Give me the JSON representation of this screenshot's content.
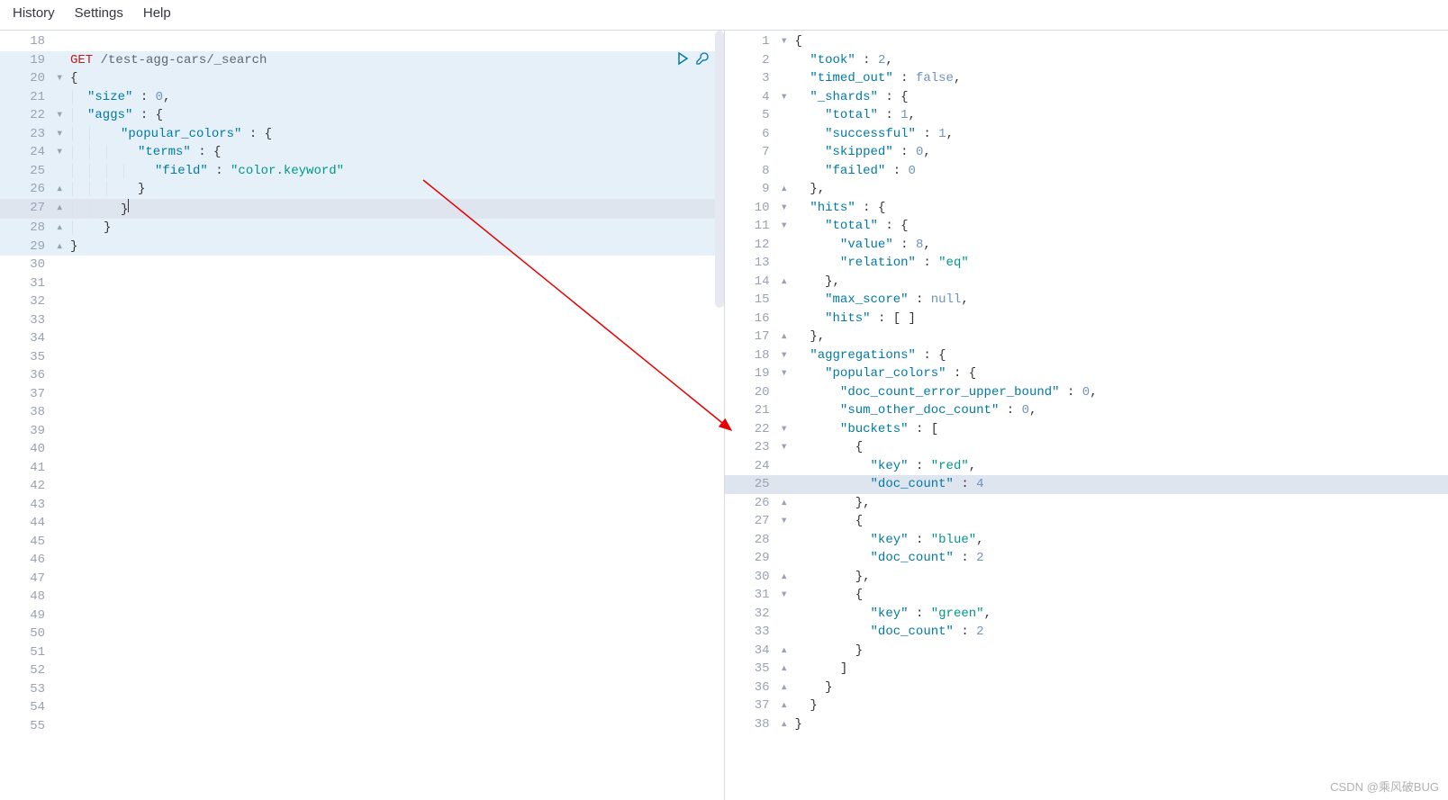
{
  "menu": {
    "history": "History",
    "settings": "Settings",
    "help": "Help"
  },
  "watermark": "CSDN @乘风破BUG",
  "leftStart": 18,
  "rightStart": 1,
  "request": {
    "method": "GET",
    "path": "/test-agg-cars/_search",
    "body": {
      "size": 0,
      "aggs": {
        "popular_colors": {
          "terms": {
            "field": "color.keyword"
          }
        }
      }
    }
  },
  "response": {
    "took": 2,
    "timed_out": false,
    "_shards": {
      "total": 1,
      "successful": 1,
      "skipped": 0,
      "failed": 0
    },
    "hits": {
      "total": {
        "value": 8,
        "relation": "eq"
      },
      "max_score": null,
      "hits": []
    },
    "aggregations": {
      "popular_colors": {
        "doc_count_error_upper_bound": 0,
        "sum_other_doc_count": 0,
        "buckets": [
          {
            "key": "red",
            "doc_count": 4
          },
          {
            "key": "blue",
            "doc_count": 2
          },
          {
            "key": "green",
            "doc_count": 2
          }
        ]
      }
    }
  },
  "leftLines": [
    {
      "n": 18,
      "f": "",
      "cls": "",
      "html": ""
    },
    {
      "n": 19,
      "f": "",
      "cls": "req-hl",
      "html": "<span class='hl-method'>GET</span> <span class='hl-path'>/test-agg-cars/_search</span>",
      "run": true
    },
    {
      "n": 20,
      "f": "▾",
      "cls": "req-hl",
      "html": "<span class='hl-punc'>{</span>"
    },
    {
      "n": 21,
      "f": "",
      "cls": "req-hl",
      "html": "<span style='border-left:1px solid #dce2ea;margin-left:2px;padding-left:16px'></span><span class='hl-key'>\"size\"</span> <span class='hl-punc'>:</span> <span class='hl-num'>0</span><span class='hl-punc'>,</span>"
    },
    {
      "n": 22,
      "f": "▾",
      "cls": "req-hl",
      "html": "<span style='border-left:1px solid #dce2ea;margin-left:2px;padding-left:16px'></span><span class='hl-key'>\"aggs\"</span> <span class='hl-punc'>:</span> <span class='hl-punc'>{</span>"
    },
    {
      "n": 23,
      "f": "▾",
      "cls": "req-hl",
      "html": "<span style='border-left:1px solid #dce2ea;margin-left:2px;padding-left:16px'></span><span style='border-left:1px solid #dce2ea;margin-left:2px;padding-left:34px'></span><span class='hl-key'>\"popular_colors\"</span> <span class='hl-punc'>:</span> <span class='hl-punc'>{</span>"
    },
    {
      "n": 24,
      "f": "▾",
      "cls": "req-hl",
      "html": "<span style='border-left:1px solid #dce2ea;margin-left:2px;padding-left:16px'></span><span style='border-left:1px solid #dce2ea;margin-left:2px;padding-left:16px'></span><span style='border-left:1px solid #dce2ea;margin-left:2px;padding-left:34px'></span><span class='hl-key'>\"terms\"</span> <span class='hl-punc'>:</span> <span class='hl-punc'>{</span>"
    },
    {
      "n": 25,
      "f": "",
      "cls": "req-hl",
      "html": "<span style='border-left:1px solid #dce2ea;margin-left:2px;padding-left:16px'></span><span style='border-left:1px solid #dce2ea;margin-left:2px;padding-left:16px'></span><span style='border-left:1px solid #dce2ea;margin-left:2px;padding-left:16px'></span><span style='border-left:1px solid #dce2ea;margin-left:2px;padding-left:34px'></span><span class='hl-key'>\"field\"</span> <span class='hl-punc'>:</span> <span class='hl-str'>\"color.keyword\"</span>"
    },
    {
      "n": 26,
      "f": "▴",
      "cls": "req-hl",
      "html": "<span style='border-left:1px solid #dce2ea;margin-left:2px;padding-left:16px'></span><span style='border-left:1px solid #dce2ea;margin-left:2px;padding-left:16px'></span><span style='border-left:1px solid #dce2ea;margin-left:2px;padding-left:34px'></span><span class='hl-punc'>}</span>"
    },
    {
      "n": 27,
      "f": "▴",
      "cls": "req-hl cursor-line",
      "html": "<span style='border-left:1px solid #dce2ea;margin-left:2px;padding-left:16px'></span><span style='border-left:1px solid #dce2ea;margin-left:2px;padding-left:34px'></span><span class='hl-punc'>}</span><span style='border-left:1px solid #333;height:15px;display:inline-block'></span>"
    },
    {
      "n": 28,
      "f": "▴",
      "cls": "req-hl",
      "html": "<span style='border-left:1px solid #dce2ea;margin-left:2px;padding-left:34px'></span><span class='hl-punc'>}</span>"
    },
    {
      "n": 29,
      "f": "▴",
      "cls": "req-hl",
      "html": "<span class='hl-punc'>}</span>"
    },
    {
      "n": 30,
      "f": "",
      "cls": "",
      "html": ""
    },
    {
      "n": 31,
      "f": "",
      "cls": "",
      "html": ""
    },
    {
      "n": 32,
      "f": "",
      "cls": "",
      "html": ""
    },
    {
      "n": 33,
      "f": "",
      "cls": "",
      "html": ""
    },
    {
      "n": 34,
      "f": "",
      "cls": "",
      "html": ""
    },
    {
      "n": 35,
      "f": "",
      "cls": "",
      "html": ""
    },
    {
      "n": 36,
      "f": "",
      "cls": "",
      "html": ""
    },
    {
      "n": 37,
      "f": "",
      "cls": "",
      "html": ""
    },
    {
      "n": 38,
      "f": "",
      "cls": "",
      "html": ""
    },
    {
      "n": 39,
      "f": "",
      "cls": "",
      "html": ""
    },
    {
      "n": 40,
      "f": "",
      "cls": "",
      "html": ""
    },
    {
      "n": 41,
      "f": "",
      "cls": "",
      "html": ""
    },
    {
      "n": 42,
      "f": "",
      "cls": "",
      "html": ""
    },
    {
      "n": 43,
      "f": "",
      "cls": "",
      "html": ""
    },
    {
      "n": 44,
      "f": "",
      "cls": "",
      "html": ""
    },
    {
      "n": 45,
      "f": "",
      "cls": "",
      "html": ""
    },
    {
      "n": 46,
      "f": "",
      "cls": "",
      "html": ""
    },
    {
      "n": 47,
      "f": "",
      "cls": "",
      "html": ""
    },
    {
      "n": 48,
      "f": "",
      "cls": "",
      "html": ""
    },
    {
      "n": 49,
      "f": "",
      "cls": "",
      "html": ""
    },
    {
      "n": 50,
      "f": "",
      "cls": "",
      "html": ""
    },
    {
      "n": 51,
      "f": "",
      "cls": "",
      "html": ""
    },
    {
      "n": 52,
      "f": "",
      "cls": "",
      "html": ""
    },
    {
      "n": 53,
      "f": "",
      "cls": "",
      "html": ""
    },
    {
      "n": 54,
      "f": "",
      "cls": "",
      "html": ""
    },
    {
      "n": 55,
      "f": "",
      "cls": "",
      "html": ""
    }
  ],
  "rightLines": [
    {
      "n": 1,
      "f": "▾",
      "html": "<span class='hl-punc'>{</span>"
    },
    {
      "n": 2,
      "f": "",
      "html": "  <span class='hl-key'>\"took\"</span> <span class='hl-punc'>:</span> <span class='hl-num'>2</span><span class='hl-punc'>,</span>"
    },
    {
      "n": 3,
      "f": "",
      "html": "  <span class='hl-key'>\"timed_out\"</span> <span class='hl-punc'>:</span> <span class='hl-bool'>false</span><span class='hl-punc'>,</span>"
    },
    {
      "n": 4,
      "f": "▾",
      "html": "  <span class='hl-key'>\"_shards\"</span> <span class='hl-punc'>:</span> <span class='hl-punc'>{</span>"
    },
    {
      "n": 5,
      "f": "",
      "html": "    <span class='hl-key'>\"total\"</span> <span class='hl-punc'>:</span> <span class='hl-num'>1</span><span class='hl-punc'>,</span>"
    },
    {
      "n": 6,
      "f": "",
      "html": "    <span class='hl-key'>\"successful\"</span> <span class='hl-punc'>:</span> <span class='hl-num'>1</span><span class='hl-punc'>,</span>"
    },
    {
      "n": 7,
      "f": "",
      "html": "    <span class='hl-key'>\"skipped\"</span> <span class='hl-punc'>:</span> <span class='hl-num'>0</span><span class='hl-punc'>,</span>"
    },
    {
      "n": 8,
      "f": "",
      "html": "    <span class='hl-key'>\"failed\"</span> <span class='hl-punc'>:</span> <span class='hl-num'>0</span>"
    },
    {
      "n": 9,
      "f": "▴",
      "html": "  <span class='hl-punc'>},</span>"
    },
    {
      "n": 10,
      "f": "▾",
      "html": "  <span class='hl-key'>\"hits\"</span> <span class='hl-punc'>:</span> <span class='hl-punc'>{</span>"
    },
    {
      "n": 11,
      "f": "▾",
      "html": "    <span class='hl-key'>\"total\"</span> <span class='hl-punc'>:</span> <span class='hl-punc'>{</span>"
    },
    {
      "n": 12,
      "f": "",
      "html": "      <span class='hl-key'>\"value\"</span> <span class='hl-punc'>:</span> <span class='hl-num'>8</span><span class='hl-punc'>,</span>"
    },
    {
      "n": 13,
      "f": "",
      "html": "      <span class='hl-key'>\"relation\"</span> <span class='hl-punc'>:</span> <span class='hl-str2'>\"eq\"</span>"
    },
    {
      "n": 14,
      "f": "▴",
      "html": "    <span class='hl-punc'>},</span>"
    },
    {
      "n": 15,
      "f": "",
      "html": "    <span class='hl-key'>\"max_score\"</span> <span class='hl-punc'>:</span> <span class='hl-null'>null</span><span class='hl-punc'>,</span>"
    },
    {
      "n": 16,
      "f": "",
      "html": "    <span class='hl-key'>\"hits\"</span> <span class='hl-punc'>:</span> <span class='hl-punc'>[ ]</span>"
    },
    {
      "n": 17,
      "f": "▴",
      "html": "  <span class='hl-punc'>},</span>"
    },
    {
      "n": 18,
      "f": "▾",
      "html": "  <span class='hl-key'>\"aggregations\"</span> <span class='hl-punc'>:</span> <span class='hl-punc'>{</span>"
    },
    {
      "n": 19,
      "f": "▾",
      "html": "    <span class='hl-key'>\"popular_colors\"</span> <span class='hl-punc'>:</span> <span class='hl-punc'>{</span>"
    },
    {
      "n": 20,
      "f": "",
      "html": "      <span class='hl-key'>\"doc_count_error_upper_bound\"</span> <span class='hl-punc'>:</span> <span class='hl-num'>0</span><span class='hl-punc'>,</span>"
    },
    {
      "n": 21,
      "f": "",
      "html": "      <span class='hl-key'>\"sum_other_doc_count\"</span> <span class='hl-punc'>:</span> <span class='hl-num'>0</span><span class='hl-punc'>,</span>"
    },
    {
      "n": 22,
      "f": "▾",
      "html": "      <span class='hl-key'>\"buckets\"</span> <span class='hl-punc'>:</span> <span class='hl-punc'>[</span>"
    },
    {
      "n": 23,
      "f": "▾",
      "html": "        <span class='hl-punc'>{</span>"
    },
    {
      "n": 24,
      "f": "",
      "html": "          <span class='hl-key'>\"key\"</span> <span class='hl-punc'>:</span> <span class='hl-str2'>\"red\"</span><span class='hl-punc'>,</span>"
    },
    {
      "n": 25,
      "f": "",
      "cls": "cursor-line",
      "html": "          <span class='hl-key'>\"doc_count\"</span> <span class='hl-punc'>:</span> <span class='hl-num'>4</span>"
    },
    {
      "n": 26,
      "f": "▴",
      "html": "        <span class='hl-punc'>},</span>"
    },
    {
      "n": 27,
      "f": "▾",
      "html": "        <span class='hl-punc'>{</span>"
    },
    {
      "n": 28,
      "f": "",
      "html": "          <span class='hl-key'>\"key\"</span> <span class='hl-punc'>:</span> <span class='hl-str2'>\"blue\"</span><span class='hl-punc'>,</span>"
    },
    {
      "n": 29,
      "f": "",
      "html": "          <span class='hl-key'>\"doc_count\"</span> <span class='hl-punc'>:</span> <span class='hl-num'>2</span>"
    },
    {
      "n": 30,
      "f": "▴",
      "html": "        <span class='hl-punc'>},</span>"
    },
    {
      "n": 31,
      "f": "▾",
      "html": "        <span class='hl-punc'>{</span>"
    },
    {
      "n": 32,
      "f": "",
      "html": "          <span class='hl-key'>\"key\"</span> <span class='hl-punc'>:</span> <span class='hl-str2'>\"green\"</span><span class='hl-punc'>,</span>"
    },
    {
      "n": 33,
      "f": "",
      "html": "          <span class='hl-key'>\"doc_count\"</span> <span class='hl-punc'>:</span> <span class='hl-num'>2</span>"
    },
    {
      "n": 34,
      "f": "▴",
      "html": "        <span class='hl-punc'>}</span>"
    },
    {
      "n": 35,
      "f": "▴",
      "html": "      <span class='hl-punc'>]</span>"
    },
    {
      "n": 36,
      "f": "▴",
      "html": "    <span class='hl-punc'>}</span>"
    },
    {
      "n": 37,
      "f": "▴",
      "html": "  <span class='hl-punc'>}</span>"
    },
    {
      "n": 38,
      "f": "▴",
      "html": "<span class='hl-punc'>}</span>"
    }
  ]
}
